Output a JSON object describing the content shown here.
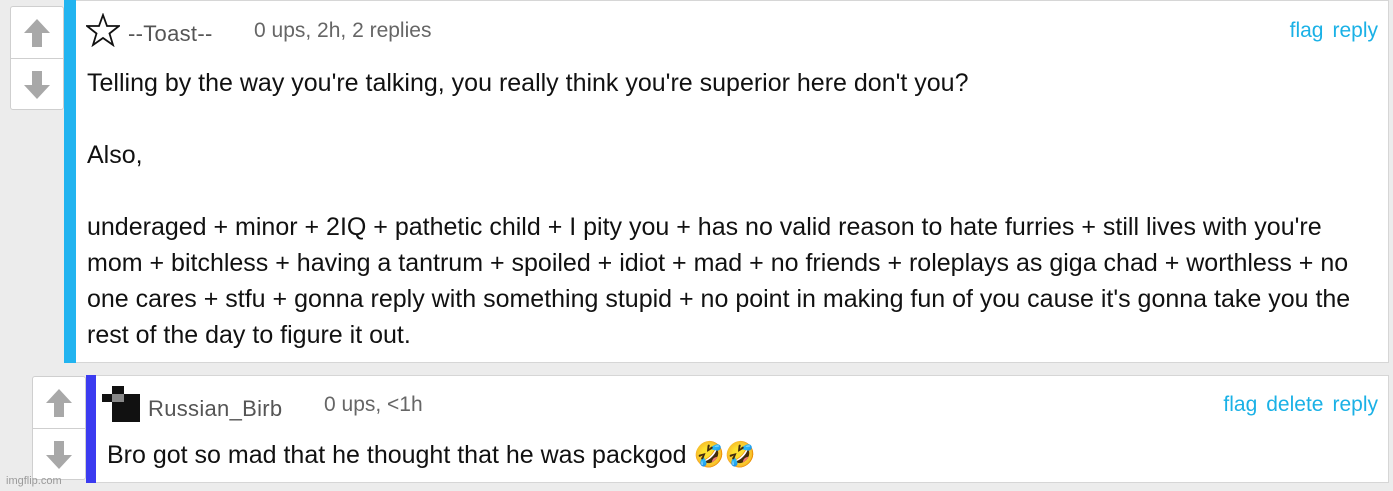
{
  "comments": [
    {
      "username": "--Toast--",
      "meta": "0 ups, 2h, 2 replies",
      "actions": [
        "flag",
        "reply"
      ],
      "accent_color": "#22b4f0",
      "avatar_icon": "star-outline-icon",
      "body": [
        "Telling by the way you're talking, you really think you're superior here don't you?",
        "Also,",
        "underaged + minor + 2IQ + pathetic child + I pity you + has no valid reason to hate furries + still lives with you're mom + bitchless + having a tantrum + spoiled + idiot + mad + no friends + roleplays as giga chad + worthless + no one cares + stfu + gonna reply with something stupid + no point in making fun of you cause it's gonna take you the rest of the day to figure it out."
      ]
    },
    {
      "username": "Russian_Birb",
      "meta": "0 ups, <1h",
      "actions": [
        "flag",
        "delete",
        "reply"
      ],
      "accent_color": "#3b3bf0",
      "avatar_icon": "pixel-bird-icon",
      "body": [
        "Bro got so mad that he thought that he was packgod 🤣🤣"
      ]
    }
  ],
  "watermark": "imgflip.com"
}
